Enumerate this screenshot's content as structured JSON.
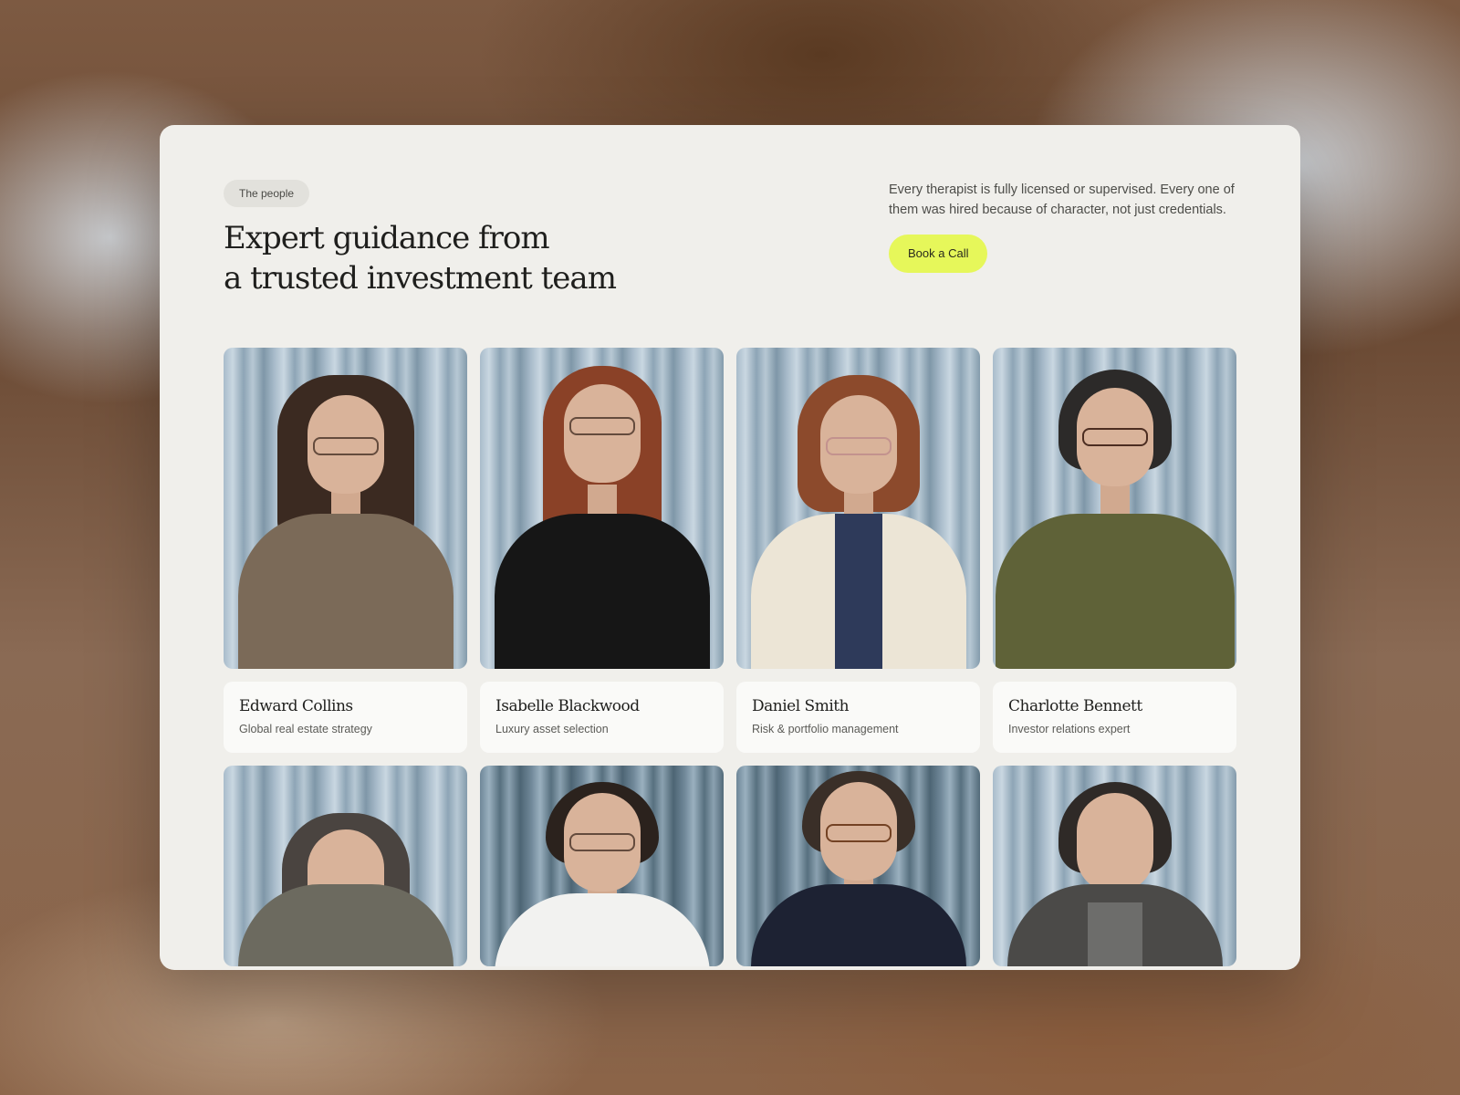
{
  "section": {
    "tag": "The people",
    "title_line1": "Expert guidance from",
    "title_line2": "a trusted investment team",
    "description": "Every therapist is fully licensed or supervised. Every one of them was hired because of character, not just credentials.",
    "cta_label": "Book a Call",
    "accent_color": "#e6f75a"
  },
  "team": [
    {
      "name": "Edward Collins",
      "role": "Global real estate strategy",
      "portrait": "woman-curly-dark-hair-glasses"
    },
    {
      "name": "Isabelle Blackwood",
      "role": "Luxury asset selection",
      "portrait": "woman-red-hair-glasses"
    },
    {
      "name": "Daniel Smith",
      "role": "Risk & portfolio management",
      "portrait": "woman-auburn-hair-cardigan"
    },
    {
      "name": "Charlotte Bennett",
      "role": "Investor relations expert",
      "portrait": "man-glasses-olive-polo"
    }
  ],
  "team_row2": [
    {
      "portrait": "woman-gray-hair-blazer"
    },
    {
      "portrait": "man-glasses-white-shirt"
    },
    {
      "portrait": "man-glasses-navy-polo"
    },
    {
      "portrait": "man-gray-beard-cardigan"
    }
  ]
}
